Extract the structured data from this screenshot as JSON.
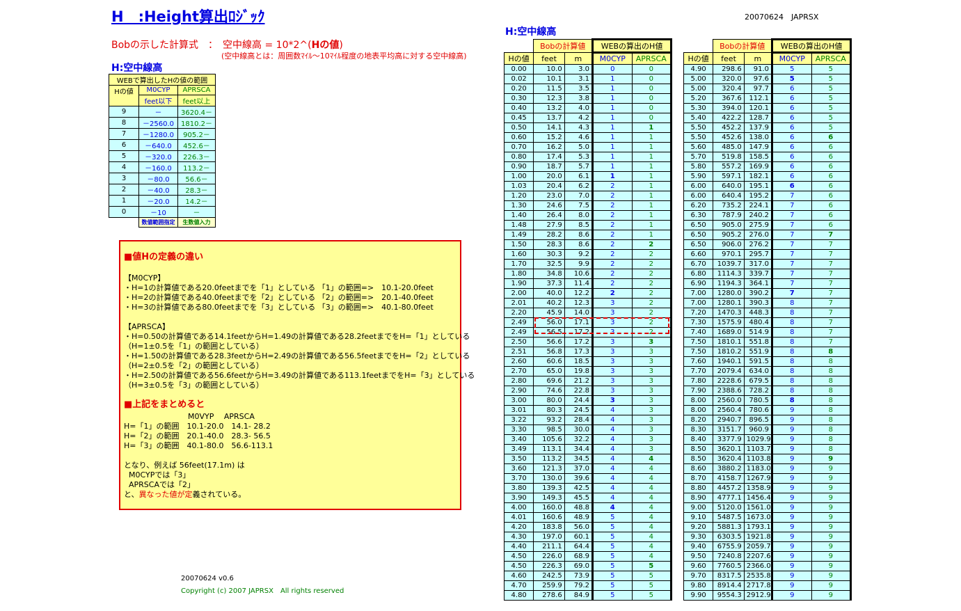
{
  "title": "H　:Height算出ﾛｼﾞｯｸ",
  "top_right": "20070624　JAPRSX",
  "formula": {
    "prefix": "Bobの示した計算式　：　空中線高 = 10*2^(",
    "bold": "Hの値",
    "suffix": ")"
  },
  "formula_note": "(空中線高とは：周囲数ﾏｲﾙ～10ﾏｲﾙ程度の地表平均高に対する空中線高)",
  "left_section_title": "H:空中線高",
  "mid_section_title": "H:空中線高",
  "range_table": {
    "header_top": "WEBで算出したHの値の範囲",
    "col_h": "Hの値",
    "col_m0cyp": [
      "M0CYP",
      "feet以下"
    ],
    "col_aprsca": [
      "APRSCA",
      "feet以上"
    ],
    "rows": [
      [
        "9",
        "－",
        "3620.4－"
      ],
      [
        "8",
        "－2560.0",
        "1810.2－"
      ],
      [
        "7",
        "－1280.0",
        "905.2－"
      ],
      [
        "6",
        "－640.0",
        "452.6－"
      ],
      [
        "5",
        "－320.0",
        "226.3－"
      ],
      [
        "4",
        "－160.0",
        "113.2－"
      ],
      [
        "3",
        "－80.0",
        "56.6－"
      ],
      [
        "2",
        "－40.0",
        "28.3－"
      ],
      [
        "1",
        "－20.0",
        "14.2－"
      ],
      [
        "0",
        "－10",
        "－"
      ]
    ],
    "foot_m0cyp": "数値範囲指定",
    "foot_aprsca": "生数値入力"
  },
  "box": {
    "heading1": "■値Hの定義の違い",
    "m0cyp_label": "【M0CYP】",
    "m0cyp_lines": [
      "・H=1の計算値である20.0feetまでを「1」としている 「1」の範囲=>　10.1-20.0feet",
      "・H=2の計算値である40.0feetまでを「2」としている 「2」の範囲=>　20.1-40.0feet",
      "・H=3の計算値である80.0feetまでを「3」としている 「3」の範囲=>　40.1-80.0feet"
    ],
    "aprsca_label": "【APRSCA】",
    "aprsca_lines": [
      "・H=0.50の計算値である14.1feetからH=1.49の計算値である28.2feetまでをH=「1」としている",
      "（H=1±0.5を「1」の範囲としている）",
      "・H=1.50の計算値である28.3feetからH=2.49の計算値である56.5feetまでをH=「2」としている",
      "（H=2±0.5を「2」の範囲としている）",
      "・H=2.50の計算値である56.6feetからH=3.49の計算値である113.1feetまでをH=「3」としている",
      "（H=3±0.5を「3」の範囲としている）"
    ],
    "heading2": "■上記をまとめると",
    "summary_header": "M0VYP　 APRSCA",
    "summary_lines": [
      "H=「1」の範囲　10.1-20.0　14.1- 28.2",
      "H=「2」の範囲　20.1-40.0　28.3- 56.5",
      "H=「3」の範囲　40.1-80.0　56.6-113.1"
    ],
    "conclusion1": "となり、例えば 56feet(17.1m) は",
    "conclusion2": "M0CYPでは「3」",
    "conclusion3": "APRSCAでは「2」",
    "conclusion4_pre": "と、",
    "conclusion4_red": "異なった値が定",
    "conclusion4_post": "義されている。"
  },
  "footer": {
    "line1": "20070624 v0.6",
    "line2": "Copyright (c) 2007 JAPRSX　All rights reserved"
  },
  "data_table_headers": {
    "bob": "Bobの計算値",
    "web": "WEBの算出のH値",
    "col_h": "Hの値",
    "col_feet": "feet",
    "col_m": "m",
    "col_m0cyp": "M0CYP",
    "col_aprsca": "APRSCA"
  },
  "table1_rows": [
    [
      "0.00",
      "10.0",
      "3.0",
      "0",
      "0"
    ],
    [
      "0.02",
      "10.1",
      "3.1",
      "1",
      "0"
    ],
    [
      "0.20",
      "11.5",
      "3.5",
      "1",
      "0"
    ],
    [
      "0.30",
      "12.3",
      "3.8",
      "1",
      "0"
    ],
    [
      "0.40",
      "13.2",
      "4.0",
      "1",
      "0"
    ],
    [
      "0.45",
      "13.7",
      "4.2",
      "1",
      "0"
    ],
    [
      "0.50",
      "14.1",
      "4.3",
      "1",
      "1"
    ],
    [
      "0.60",
      "15.2",
      "4.6",
      "1",
      "1"
    ],
    [
      "0.70",
      "16.2",
      "5.0",
      "1",
      "1"
    ],
    [
      "0.80",
      "17.4",
      "5.3",
      "1",
      "1"
    ],
    [
      "0.90",
      "18.7",
      "5.7",
      "1",
      "1"
    ],
    [
      "1.00",
      "20.0",
      "6.1",
      "1",
      "1"
    ],
    [
      "1.03",
      "20.4",
      "6.2",
      "2",
      "1"
    ],
    [
      "1.20",
      "23.0",
      "7.0",
      "2",
      "1"
    ],
    [
      "1.30",
      "24.6",
      "7.5",
      "2",
      "1"
    ],
    [
      "1.40",
      "26.4",
      "8.0",
      "2",
      "1"
    ],
    [
      "1.48",
      "27.9",
      "8.5",
      "2",
      "1"
    ],
    [
      "1.49",
      "28.2",
      "8.6",
      "2",
      "1"
    ],
    [
      "1.50",
      "28.3",
      "8.6",
      "2",
      "2"
    ],
    [
      "1.60",
      "30.3",
      "9.2",
      "2",
      "2"
    ],
    [
      "1.70",
      "32.5",
      "9.9",
      "2",
      "2"
    ],
    [
      "1.80",
      "34.8",
      "10.6",
      "2",
      "2"
    ],
    [
      "1.90",
      "37.3",
      "11.4",
      "2",
      "2"
    ],
    [
      "2.00",
      "40.0",
      "12.2",
      "2",
      "2"
    ],
    [
      "2.01",
      "40.2",
      "12.3",
      "3",
      "2"
    ],
    [
      "2.20",
      "45.9",
      "14.0",
      "3",
      "2"
    ],
    [
      "2.49",
      "56.0",
      "17.1",
      "3",
      "2"
    ],
    [
      "2.49",
      "56.5",
      "17.2",
      "3",
      "2"
    ],
    [
      "2.50",
      "56.6",
      "17.2",
      "3",
      "3"
    ],
    [
      "2.51",
      "56.8",
      "17.3",
      "3",
      "3"
    ],
    [
      "2.60",
      "60.6",
      "18.5",
      "3",
      "3"
    ],
    [
      "2.70",
      "65.0",
      "19.8",
      "3",
      "3"
    ],
    [
      "2.80",
      "69.6",
      "21.2",
      "3",
      "3"
    ],
    [
      "2.90",
      "74.6",
      "22.8",
      "3",
      "3"
    ],
    [
      "3.00",
      "80.0",
      "24.4",
      "3",
      "3"
    ],
    [
      "3.01",
      "80.3",
      "24.5",
      "4",
      "3"
    ],
    [
      "3.22",
      "93.2",
      "28.4",
      "4",
      "3"
    ],
    [
      "3.30",
      "98.5",
      "30.0",
      "4",
      "3"
    ],
    [
      "3.40",
      "105.6",
      "32.2",
      "4",
      "3"
    ],
    [
      "3.49",
      "113.1",
      "34.4",
      "4",
      "3"
    ],
    [
      "3.50",
      "113.2",
      "34.5",
      "4",
      "4"
    ],
    [
      "3.60",
      "121.3",
      "37.0",
      "4",
      "4"
    ],
    [
      "3.70",
      "130.0",
      "39.6",
      "4",
      "4"
    ],
    [
      "3.80",
      "139.3",
      "42.5",
      "4",
      "4"
    ],
    [
      "3.90",
      "149.3",
      "45.5",
      "4",
      "4"
    ],
    [
      "4.00",
      "160.0",
      "48.8",
      "4",
      "4"
    ],
    [
      "4.01",
      "160.6",
      "48.9",
      "5",
      "4"
    ],
    [
      "4.20",
      "183.8",
      "56.0",
      "5",
      "4"
    ],
    [
      "4.30",
      "197.0",
      "60.1",
      "5",
      "4"
    ],
    [
      "4.40",
      "211.1",
      "64.4",
      "5",
      "4"
    ],
    [
      "4.50",
      "226.0",
      "68.9",
      "5",
      "4"
    ],
    [
      "4.50",
      "226.3",
      "69.0",
      "5",
      "5"
    ],
    [
      "4.60",
      "242.5",
      "73.9",
      "5",
      "5"
    ],
    [
      "4.70",
      "259.9",
      "79.2",
      "5",
      "5"
    ],
    [
      "4.80",
      "278.6",
      "84.9",
      "5",
      "5"
    ]
  ],
  "table2_rows": [
    [
      "4.90",
      "298.6",
      "91.0",
      "5",
      "5"
    ],
    [
      "5.00",
      "320.0",
      "97.6",
      "5",
      "5"
    ],
    [
      "5.00",
      "320.4",
      "97.7",
      "6",
      "5"
    ],
    [
      "5.20",
      "367.6",
      "112.1",
      "6",
      "5"
    ],
    [
      "5.30",
      "394.0",
      "120.1",
      "6",
      "5"
    ],
    [
      "5.40",
      "422.2",
      "128.7",
      "6",
      "5"
    ],
    [
      "5.50",
      "452.2",
      "137.9",
      "6",
      "5"
    ],
    [
      "5.50",
      "452.6",
      "138.0",
      "6",
      "6"
    ],
    [
      "5.60",
      "485.0",
      "147.9",
      "6",
      "6"
    ],
    [
      "5.70",
      "519.8",
      "158.5",
      "6",
      "6"
    ],
    [
      "5.80",
      "557.2",
      "169.9",
      "6",
      "6"
    ],
    [
      "5.90",
      "597.1",
      "182.1",
      "6",
      "6"
    ],
    [
      "6.00",
      "640.0",
      "195.1",
      "6",
      "6"
    ],
    [
      "6.00",
      "640.4",
      "195.2",
      "7",
      "6"
    ],
    [
      "6.20",
      "735.2",
      "224.1",
      "7",
      "6"
    ],
    [
      "6.30",
      "787.9",
      "240.2",
      "7",
      "6"
    ],
    [
      "6.50",
      "905.0",
      "275.9",
      "7",
      "6"
    ],
    [
      "6.50",
      "905.2",
      "276.0",
      "7",
      "7"
    ],
    [
      "6.50",
      "906.0",
      "276.2",
      "7",
      "7"
    ],
    [
      "6.60",
      "970.1",
      "295.7",
      "7",
      "7"
    ],
    [
      "6.70",
      "1039.7",
      "317.0",
      "7",
      "7"
    ],
    [
      "6.80",
      "1114.3",
      "339.7",
      "7",
      "7"
    ],
    [
      "6.90",
      "1194.3",
      "364.1",
      "7",
      "7"
    ],
    [
      "7.00",
      "1280.0",
      "390.2",
      "7",
      "7"
    ],
    [
      "7.00",
      "1280.1",
      "390.3",
      "8",
      "7"
    ],
    [
      "7.20",
      "1470.3",
      "448.3",
      "8",
      "7"
    ],
    [
      "7.30",
      "1575.9",
      "480.4",
      "8",
      "7"
    ],
    [
      "7.40",
      "1689.0",
      "514.9",
      "8",
      "7"
    ],
    [
      "7.50",
      "1810.1",
      "551.8",
      "8",
      "7"
    ],
    [
      "7.50",
      "1810.2",
      "551.9",
      "8",
      "8"
    ],
    [
      "7.60",
      "1940.1",
      "591.5",
      "8",
      "8"
    ],
    [
      "7.70",
      "2079.4",
      "634.0",
      "8",
      "8"
    ],
    [
      "7.80",
      "2228.6",
      "679.5",
      "8",
      "8"
    ],
    [
      "7.90",
      "2388.6",
      "728.2",
      "8",
      "8"
    ],
    [
      "8.00",
      "2560.0",
      "780.5",
      "8",
      "8"
    ],
    [
      "8.00",
      "2560.4",
      "780.6",
      "9",
      "8"
    ],
    [
      "8.20",
      "2940.7",
      "896.5",
      "9",
      "8"
    ],
    [
      "8.30",
      "3151.7",
      "960.9",
      "9",
      "8"
    ],
    [
      "8.40",
      "3377.9",
      "1029.9",
      "9",
      "8"
    ],
    [
      "8.50",
      "3620.1",
      "1103.7",
      "9",
      "8"
    ],
    [
      "8.50",
      "3620.4",
      "1103.8",
      "9",
      "9"
    ],
    [
      "8.60",
      "3880.2",
      "1183.0",
      "9",
      "9"
    ],
    [
      "8.70",
      "4158.7",
      "1267.9",
      "9",
      "9"
    ],
    [
      "8.80",
      "4457.2",
      "1358.9",
      "9",
      "9"
    ],
    [
      "8.90",
      "4777.1",
      "1456.4",
      "9",
      "9"
    ],
    [
      "9.00",
      "5120.0",
      "1561.0",
      "9",
      "9"
    ],
    [
      "9.10",
      "5487.5",
      "1673.0",
      "9",
      "9"
    ],
    [
      "9.20",
      "5881.3",
      "1793.1",
      "9",
      "9"
    ],
    [
      "9.30",
      "6303.5",
      "1921.8",
      "9",
      "9"
    ],
    [
      "9.40",
      "6755.9",
      "2059.7",
      "9",
      "9"
    ],
    [
      "9.50",
      "7240.8",
      "2207.6",
      "9",
      "9"
    ],
    [
      "9.60",
      "7760.5",
      "2366.0",
      "9",
      "9"
    ],
    [
      "9.70",
      "8317.5",
      "2535.8",
      "9",
      "9"
    ],
    [
      "9.80",
      "8914.4",
      "2717.8",
      "9",
      "9"
    ],
    [
      "9.90",
      "9554.3",
      "2912.9",
      "9",
      "9"
    ]
  ],
  "table1_bold_m0cyp": [
    11,
    23,
    34,
    45
  ],
  "table1_bold_aprsca": [
    6,
    18,
    28,
    40,
    51
  ],
  "table2_bold_m0cyp": [
    1,
    12,
    23,
    34
  ],
  "table2_bold_aprsca": [
    7,
    17,
    29,
    40
  ]
}
